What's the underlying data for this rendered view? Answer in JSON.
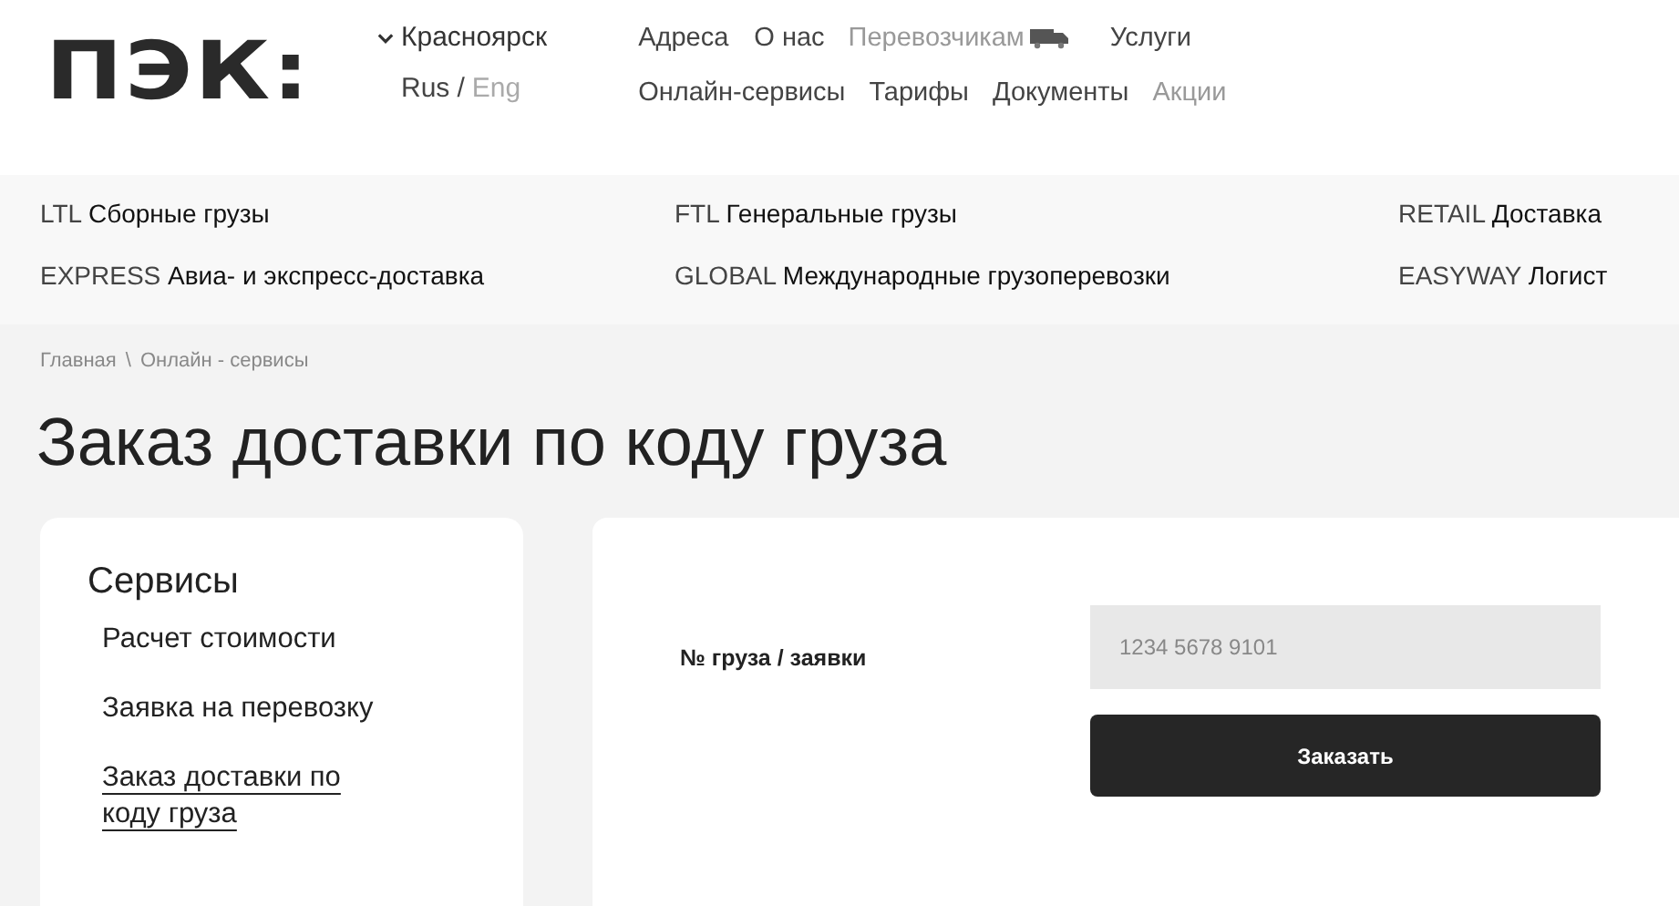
{
  "logo": "ПЭК:",
  "city": "Красноярск",
  "language_separator": "/",
  "languages": [
    {
      "label": "Rus",
      "selected": true
    },
    {
      "label": "Eng",
      "selected": false
    }
  ],
  "nav_rows": [
    [
      {
        "label": "Адреса",
        "muted": false
      },
      {
        "label": "О нас",
        "muted": false
      },
      {
        "label": "Перевозчикам",
        "muted": true,
        "kind": "truck"
      },
      {
        "label": "Услуги",
        "muted": false
      }
    ],
    [
      {
        "label": "Онлайн-сервисы",
        "muted": false
      },
      {
        "label": "Тарифы",
        "muted": false
      },
      {
        "label": "Документы",
        "muted": false
      },
      {
        "label": "Акции",
        "muted": true
      }
    ]
  ],
  "categories": [
    {
      "code": "LTL",
      "name": "Сборные грузы"
    },
    {
      "code": "FTL",
      "name": "Генеральные грузы"
    },
    {
      "code": "RETAIL",
      "name": "Доставка"
    },
    {
      "code": "EXPRESS",
      "name": "Авиа- и экспресс-доставка"
    },
    {
      "code": "GLOBAL",
      "name": "Международные грузоперевозки"
    },
    {
      "code": "EASYWAY",
      "name": "Логист"
    }
  ],
  "breadcrumb": [
    "Главная",
    "\\",
    "Онлайн - сервисы"
  ],
  "page_title": "Заказ доставки по коду груза",
  "sidebar": {
    "title": "Сервисы",
    "items": [
      {
        "label": "Расчет стоимости",
        "selected": false
      },
      {
        "label": "Заявка на перевозку",
        "selected": false
      },
      {
        "label": "Заказ доставки по коду груза",
        "selected": true
      }
    ]
  },
  "form": {
    "label": "№ груза / заявки",
    "placeholder": "1234 5678 9101",
    "button": "Заказать"
  }
}
